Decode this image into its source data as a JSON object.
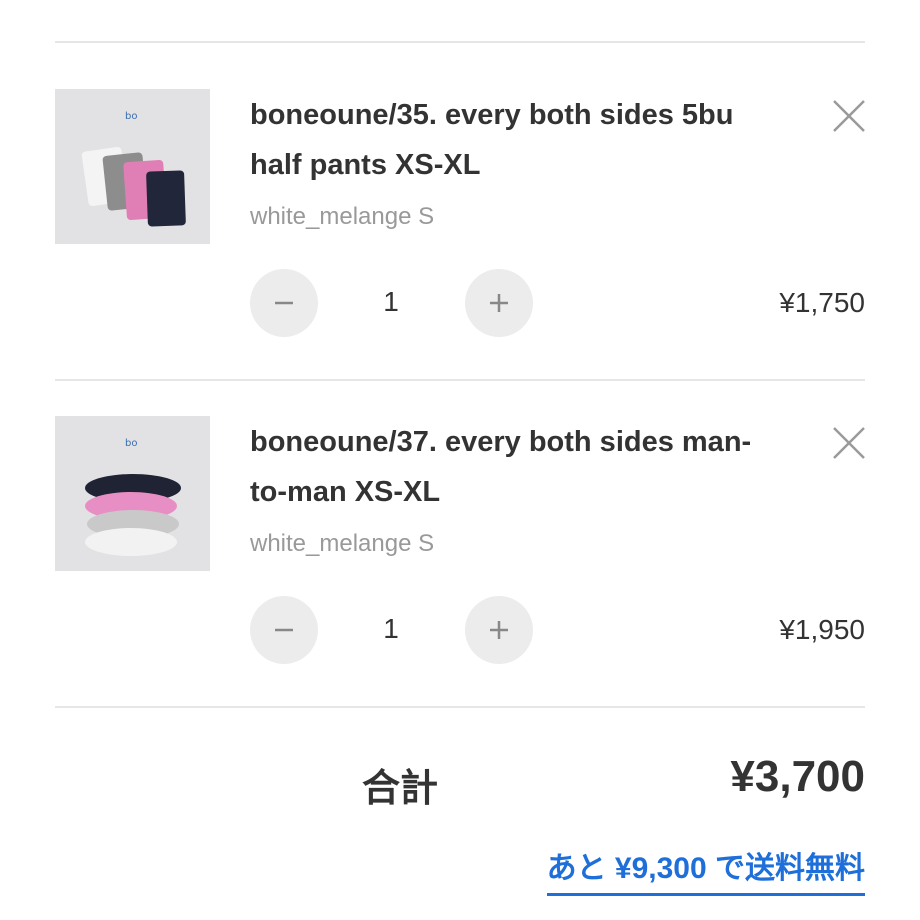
{
  "cart": {
    "items": [
      {
        "title_line1": "boneoune/35. every both sides 5bu",
        "title_line2": "half pants XS-XL",
        "variant": "white_melange S",
        "quantity": "1",
        "price": "¥1,750",
        "thumbnail_icon": "product-photo-half-pants",
        "remove_icon": "close-icon",
        "decrease_icon": "minus-icon",
        "increase_icon": "plus-icon"
      },
      {
        "title_line1": "boneoune/37. every both sides man-",
        "title_line2": "to-man XS-XL",
        "variant": "white_melange S",
        "quantity": "1",
        "price": "¥1,950",
        "thumbnail_icon": "product-photo-sweatshirts",
        "remove_icon": "close-icon",
        "decrease_icon": "minus-icon",
        "increase_icon": "plus-icon"
      }
    ]
  },
  "summary": {
    "total_label": "合計",
    "total_value": "¥3,700",
    "free_shipping_note": "あと ¥9,300 で送料無料"
  },
  "colors": {
    "accent_link": "#1e6fd9",
    "text_primary": "#333333",
    "text_secondary": "#999999",
    "button_bg": "#ececec",
    "divider": "#e6e6e6"
  }
}
